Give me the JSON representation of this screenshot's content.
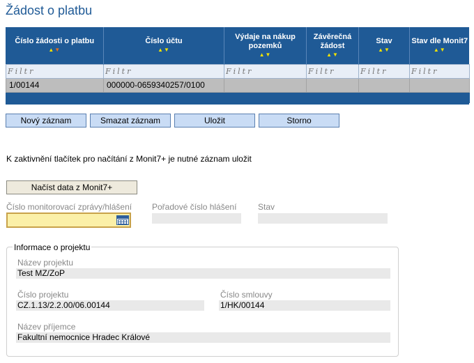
{
  "page_title": "Žádost o platbu",
  "grid": {
    "columns": [
      {
        "label": "Číslo žádosti o platbu",
        "sort_active": true
      },
      {
        "label": "Číslo účtu",
        "sort_active": false
      },
      {
        "label": "Výdaje na nákup pozemků",
        "sort_active": false
      },
      {
        "label": "Závěrečná žádost",
        "sort_active": false
      },
      {
        "label": "Stav",
        "sort_active": false
      },
      {
        "label": "Stav dle Monit7",
        "sort_active": false
      }
    ],
    "filter_placeholder": "Filtr",
    "rows": [
      [
        "1/00144",
        "000000-0659340257/0100",
        "",
        "",
        "",
        ""
      ]
    ]
  },
  "buttons": {
    "new": "Nový záznam",
    "delete": "Smazat záznam",
    "save": "Uložit",
    "cancel": "Storno"
  },
  "note": "K zaktivnění tlačítek pro načítání z Monit7+ je nutné záznam uložit",
  "load_button": "Načíst data z Monit7+",
  "monit": {
    "report_no_label": "Číslo monitorovací zprávy/hlášení",
    "report_no_value": "",
    "order_no_label": "Pořadové číslo hlášení",
    "order_no_value": "",
    "status_label": "Stav",
    "status_value": ""
  },
  "project_info": {
    "legend": "Informace o projektu",
    "name_label": "Název projektu",
    "name_value": "Test MZ/ZoP",
    "number_label": "Číslo projektu",
    "number_value": "CZ.1.13/2.2.00/06.00144",
    "contract_label": "Číslo smlouvy",
    "contract_value": "1/HK/00144",
    "recipient_label": "Název příjemce",
    "recipient_value": "Fakultní nemocnice Hradec Králové"
  }
}
